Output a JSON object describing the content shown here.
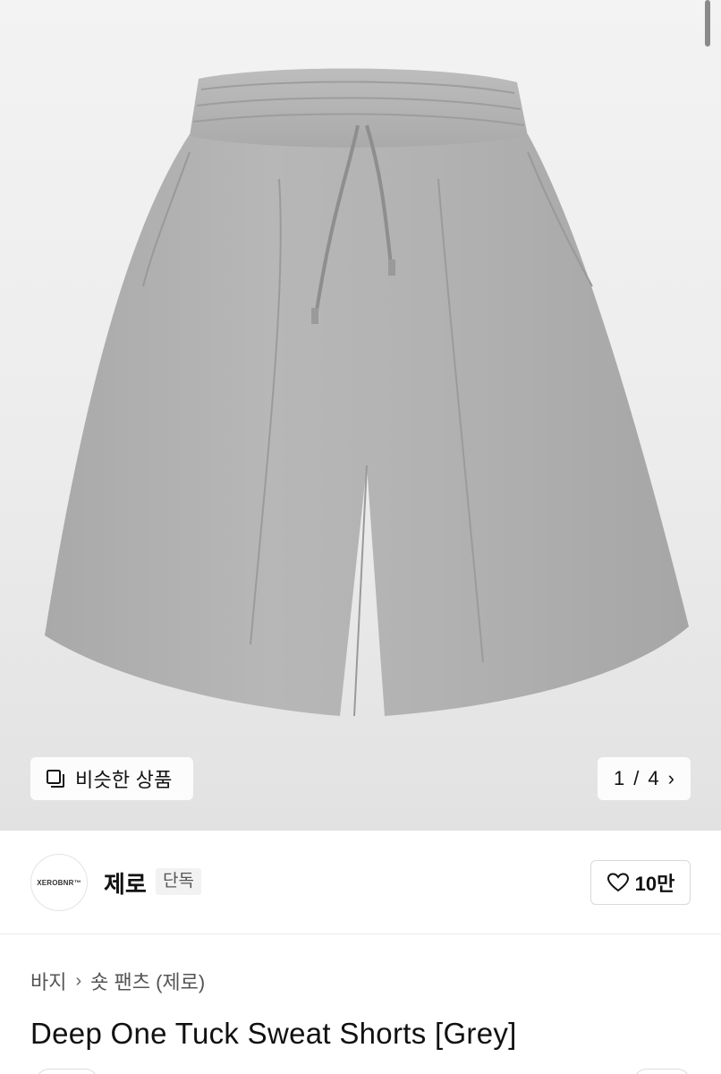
{
  "gallery": {
    "similar_label": "비슷한 상품",
    "counter_current": "1",
    "counter_sep": "/",
    "counter_total": "4",
    "next_icon": "chevron-right-icon",
    "similar_icon": "stacked-squares-icon"
  },
  "brand": {
    "logo_text": "XEROBNR™",
    "name": "제로",
    "badge": "단독",
    "like_icon": "heart-outline-icon",
    "like_count": "10만"
  },
  "breadcrumb": {
    "items": [
      "바지",
      "숏 팬츠 (제로)"
    ],
    "separator_icon": "chevron-right-icon"
  },
  "product": {
    "title": "Deep One Tuck Sweat Shorts [Grey]",
    "image_subject": "grey sweat shorts"
  },
  "colors": {
    "garment": "#b4b4b4",
    "background": "#ececec",
    "text": "#111111",
    "muted": "#555555"
  }
}
